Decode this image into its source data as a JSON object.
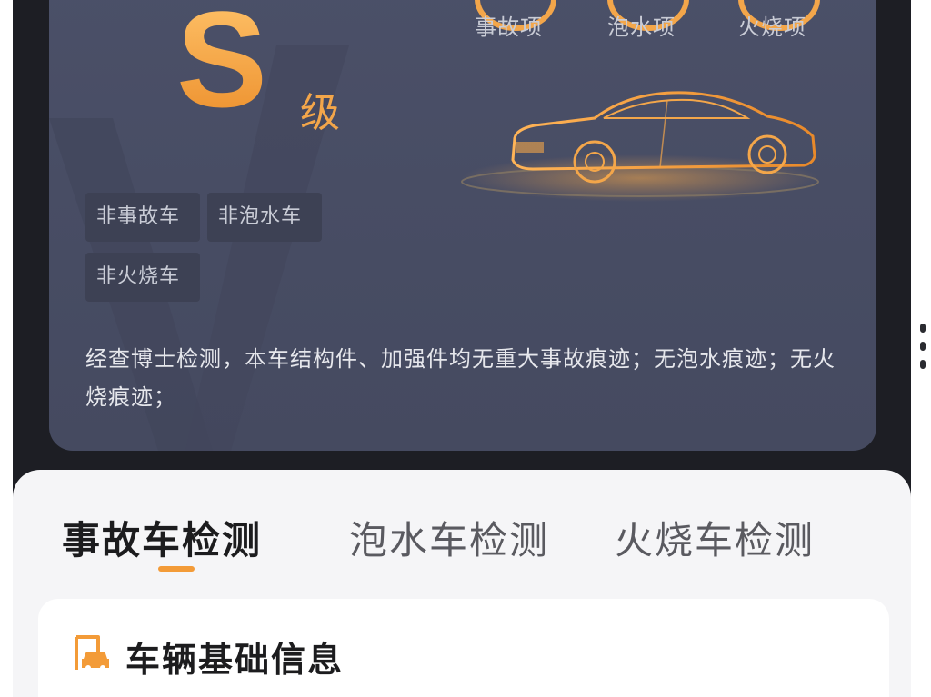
{
  "report": {
    "grade": "S",
    "grade_suffix": "级",
    "stats": [
      {
        "label": "事故项"
      },
      {
        "label": "泡水项"
      },
      {
        "label": "火烧项"
      }
    ],
    "tags": [
      "非事故车",
      "非泡水车",
      "非火烧车"
    ],
    "summary": "经查博士检测，本车结构件、加强件均无重大事故痕迹；无泡水痕迹；无火烧痕迹；"
  },
  "tabs": [
    {
      "label": "事故车检测",
      "active": true
    },
    {
      "label": "泡水车检测",
      "active": false
    },
    {
      "label": "火烧车检测",
      "active": false
    }
  ],
  "info_card": {
    "title": "车辆基础信息",
    "icon": "car-document-icon"
  },
  "colors": {
    "accent": "#f39b38",
    "card_bg": "#4b5068",
    "frame_bg": "#1d1e24",
    "sheet_bg": "#f5f5f7"
  }
}
